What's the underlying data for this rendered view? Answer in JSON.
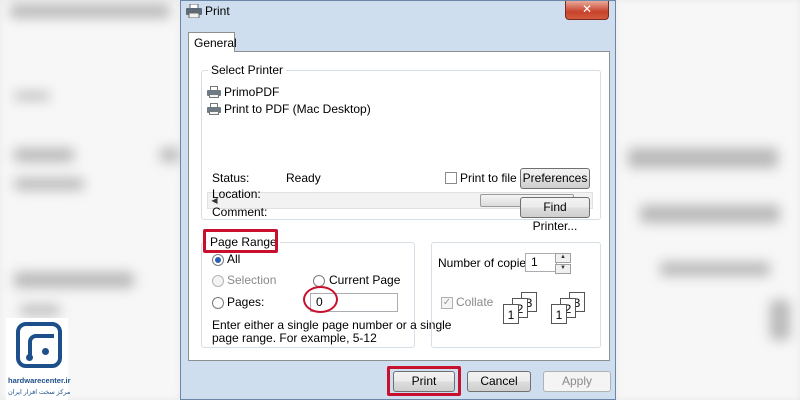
{
  "window": {
    "title": "Print",
    "close_glyph": "✕",
    "tab_label": "General"
  },
  "select_printer": {
    "label": "Select Printer",
    "printers": [
      "PrimoPDF",
      "Print to PDF (Mac Desktop)"
    ],
    "scroll_thumb_glyph": "III",
    "scroll_left_glyph": "◀",
    "scroll_right_glyph": "▶"
  },
  "status": {
    "status_label": "Status:",
    "status_value": "Ready",
    "location_label": "Location:",
    "comment_label": "Comment:",
    "print_to_file_label": "Print to file",
    "preferences_button": "Preferences",
    "find_printer_button": "Find Printer..."
  },
  "page_range": {
    "label": "Page Range",
    "all_label": "All",
    "selection_label": "Selection",
    "current_page_label": "Current Page",
    "pages_label": "Pages:",
    "pages_value": "0",
    "help_text_line1": "Enter either a single page number or a single",
    "help_text_line2": "page range.  For example, 5-12"
  },
  "copies": {
    "label": "Number of copies:",
    "value": "1",
    "collate_label": "Collate",
    "collate_checked": true,
    "sheet_numbers": [
      "1",
      "2",
      "3"
    ]
  },
  "buttons": {
    "print": "Print",
    "cancel": "Cancel",
    "apply": "Apply"
  },
  "logo": {
    "site": "hardwarecenter.ir",
    "tagline": "مرکز سخت افزار ایران"
  },
  "colors": {
    "annotation": "#c8102e",
    "dialog_frame": "#cfdeef",
    "logo_blue": "#1d4f8a"
  },
  "icons": {
    "title": "printer-icon",
    "close": "close-icon",
    "printer_items": "printer-icon",
    "spinner": "spinner-arrows-icon"
  }
}
